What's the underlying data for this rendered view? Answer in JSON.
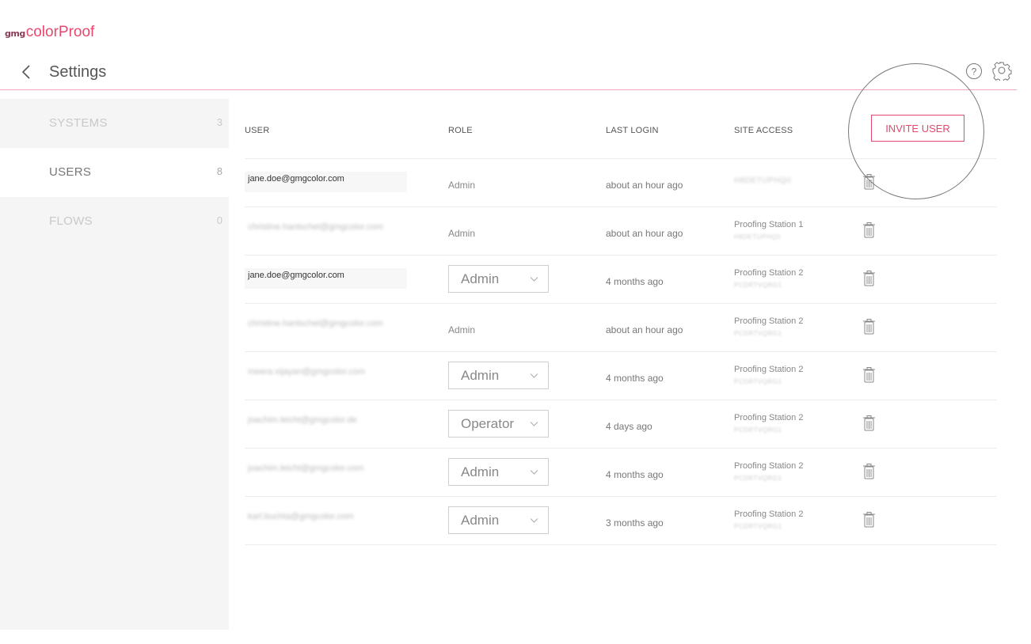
{
  "app": {
    "logo_small": "gmg",
    "logo_name": "colorProof"
  },
  "header": {
    "title": "Settings"
  },
  "sidebar": {
    "items": [
      {
        "label": "SYSTEMS",
        "count": "3"
      },
      {
        "label": "USERS",
        "count": "8"
      },
      {
        "label": "FLOWS",
        "count": "0"
      }
    ]
  },
  "table": {
    "columns": {
      "user": "USER",
      "role": "ROLE",
      "last_login": "LAST LOGIN",
      "site_access": "SITE ACCESS"
    },
    "invite_label": "INVITE USER",
    "rows": [
      {
        "email": "jane.doe@gmgcolor.com",
        "role": "Admin",
        "last_login": "about an hour ago",
        "site": "",
        "site_id": "H8DETUPHQ0"
      },
      {
        "email": "christine.hantschel@gmgcolor.com",
        "role": "Admin",
        "last_login": "about an hour ago",
        "site": "Proofing Station 1",
        "site_id": "H8DETUPHQ0"
      },
      {
        "email": "jane.doe@gmgcolor.com",
        "role": "Admin",
        "last_login": "4 months ago",
        "site": "Proofing Station 2",
        "site_id": "PCDRTVQRG1"
      },
      {
        "email": "christine.hantschel@gmgcolor.com",
        "role": "Admin",
        "last_login": "about an hour ago",
        "site": "Proofing Station 2",
        "site_id": "PCDRTVQRG1"
      },
      {
        "email": "meera.vijayan@gmgcolor.com",
        "role": "Admin",
        "last_login": "4 months ago",
        "site": "Proofing Station 2",
        "site_id": "PCDRTVQRG1"
      },
      {
        "email": "joachim.leicht@gmgcolor.de",
        "role": "Operator",
        "last_login": "4 days ago",
        "site": "Proofing Station 2",
        "site_id": "PCDRTVQRG1"
      },
      {
        "email": "joachim.leicht@gmgcolor.com",
        "role": "Admin",
        "last_login": "4 months ago",
        "site": "Proofing Station 2",
        "site_id": "PCDRTVQRG1"
      },
      {
        "email": "karl.buchta@gmgcolor.com",
        "role": "Admin",
        "last_login": "3 months ago",
        "site": "Proofing Station 2",
        "site_id": "PCDRTVQRG1"
      }
    ]
  },
  "icons": {
    "back": "chevron-left-icon",
    "help": "help-circle-icon",
    "settings": "gear-icon",
    "delete": "trash-icon",
    "dropdown": "chevron-down-icon"
  },
  "colors": {
    "accent": "#e6486e",
    "sidebar_bg": "#f5f5f5",
    "divider": "#f0a7ba"
  }
}
